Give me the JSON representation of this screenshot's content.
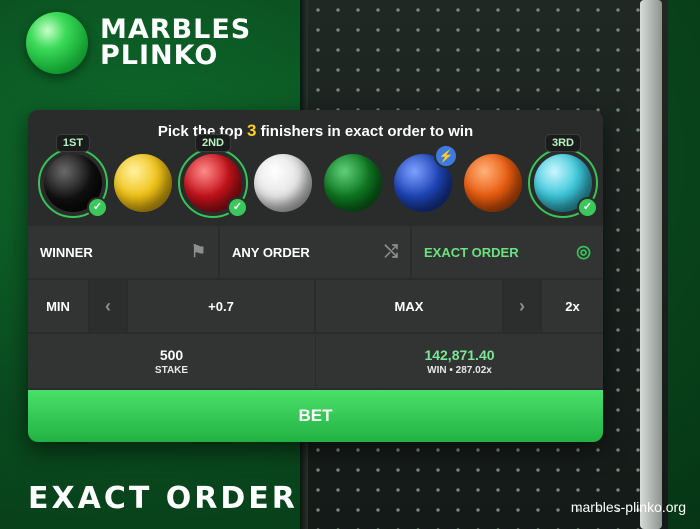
{
  "logo": {
    "line1": "MARBLES",
    "line2": "PLINKO"
  },
  "headline": {
    "prefix": "Pick the top ",
    "number": "3",
    "suffix": " finishers in exact order to win"
  },
  "balls": [
    {
      "name": "black",
      "color": "#111111",
      "badge": "1ST",
      "checked": true
    },
    {
      "name": "yellow",
      "color": "#f0c318"
    },
    {
      "name": "red",
      "color": "#c4141b",
      "badge": "2ND",
      "checked": true
    },
    {
      "name": "white",
      "color": "#e6e6e6"
    },
    {
      "name": "green",
      "color": "#0f7a22"
    },
    {
      "name": "blue",
      "color": "#1f46b8",
      "boost": true
    },
    {
      "name": "orange",
      "color": "#e85c0f"
    },
    {
      "name": "cyan",
      "color": "#3dc7da",
      "badge": "3RD",
      "checked": true
    }
  ],
  "modes": {
    "winner": "WINNER",
    "any_order": "ANY ORDER",
    "exact_order": "EXACT ORDER"
  },
  "stake_controls": {
    "min": "MIN",
    "plus": "+0.7",
    "max": "MAX",
    "multiplier": "2x"
  },
  "summary": {
    "stake_value": "500",
    "stake_label": "STAKE",
    "win_value": "142,871.40",
    "win_label": "WIN • 287.02x"
  },
  "bet_label": "BET",
  "footer": {
    "title": "EXACT ORDER",
    "site": "marbles-plinko.org"
  },
  "colors": {
    "accent": "#39c45a",
    "highlight": "#ffcf24"
  }
}
